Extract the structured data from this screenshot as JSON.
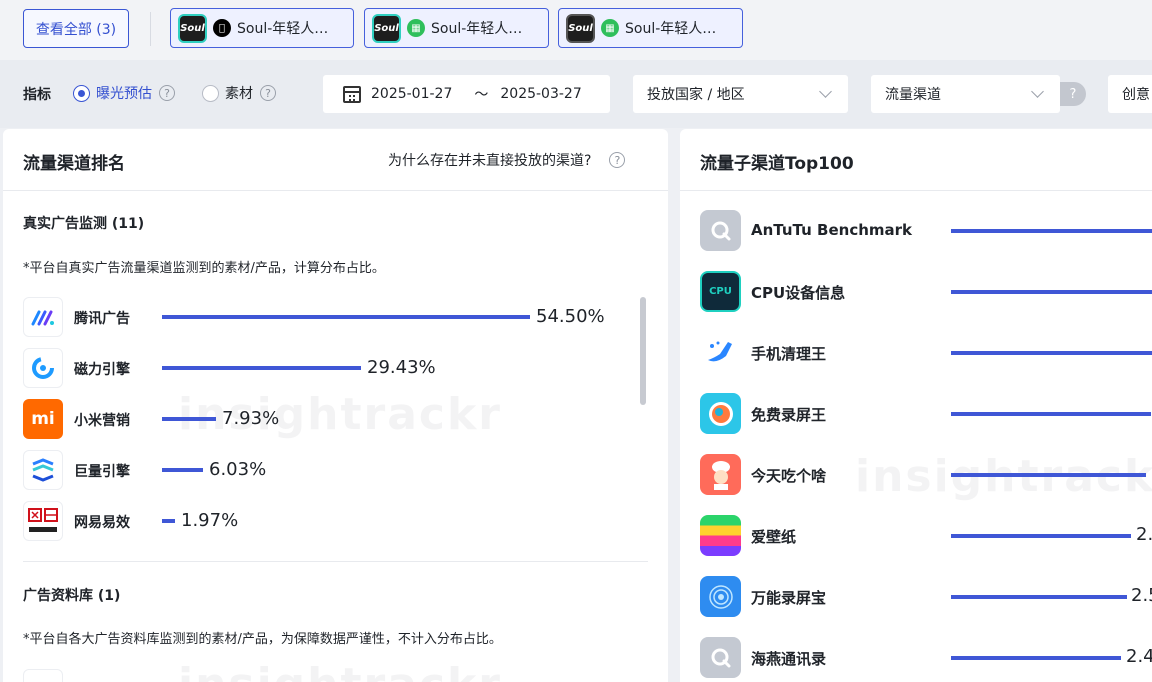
{
  "topbar": {
    "view_all_label": "查看全部 (3)",
    "apps": [
      {
        "icon_text": "Soul",
        "platform": "ios",
        "label": "Soul-年轻人…"
      },
      {
        "icon_text": "Soul",
        "platform": "android",
        "label": "Soul-年轻人…"
      },
      {
        "icon_text": "Soul",
        "platform": "android",
        "label": "Soul-年轻人…"
      }
    ]
  },
  "filters": {
    "metric_label": "指标",
    "radio_exposure": "曝光预估",
    "radio_creative": "素材",
    "date_start": "2025-01-27",
    "date_sep": "～",
    "date_end": "2025-03-27",
    "country_placeholder": "投放国家 / 地区",
    "channel_placeholder": "流量渠道",
    "help_icon_text": "?",
    "creative_partial": "创意"
  },
  "left_panel": {
    "title": "流量渠道排名",
    "why_text": "为什么存在并未直接投放的渠道?",
    "section1_title": "真实广告监测 (11)",
    "section1_note": "*平台自真实广告流量渠道监测到的素材/产品，计算分布占比。",
    "channels": [
      {
        "name": "腾讯广告",
        "percent_text": "54.50%",
        "percent": 54.5,
        "icon": "tencent-ads-logo"
      },
      {
        "name": "磁力引擎",
        "percent_text": "29.43%",
        "percent": 29.43,
        "icon": "cili-engine-logo"
      },
      {
        "name": "小米营销",
        "percent_text": "7.93%",
        "percent": 7.93,
        "icon": "xiaomi-logo"
      },
      {
        "name": "巨量引擎",
        "percent_text": "6.03%",
        "percent": 6.03,
        "icon": "oceanengine-logo"
      },
      {
        "name": "网易易效",
        "percent_text": "1.97%",
        "percent": 1.97,
        "icon": "netease-logo"
      }
    ],
    "section2_title": "广告资料库 (1)",
    "section2_note": "*平台自各大广告资料库监测到的素材/产品，为保障数据严谨性，不计入分布占比。",
    "watermark": "insightrackr"
  },
  "right_panel": {
    "title": "流量子渠道Top100",
    "items": [
      {
        "name": "AnTuTu Benchmark",
        "value_text": "",
        "icon": "antutu-logo"
      },
      {
        "name": "CPU设备信息",
        "value_text": "",
        "icon": "cpu-logo"
      },
      {
        "name": "手机清理王",
        "value_text": "",
        "icon": "cleaner-logo"
      },
      {
        "name": "免费录屏王",
        "value_text": "",
        "icon": "screen-recorder-logo"
      },
      {
        "name": "今天吃个啥",
        "value_text": "",
        "icon": "chef-logo"
      },
      {
        "name": "爱壁纸",
        "value_text": "2.",
        "icon": "wallpaper-logo"
      },
      {
        "name": "万能录屏宝",
        "value_text": "2.5",
        "icon": "recorder-bao-logo"
      },
      {
        "name": "海燕通讯录",
        "value_text": "2.4",
        "icon": "contacts-logo"
      }
    ],
    "watermark": "insightrackr"
  },
  "colors": {
    "accent": "#3f57d6",
    "xiaomi": "#ff6900"
  }
}
